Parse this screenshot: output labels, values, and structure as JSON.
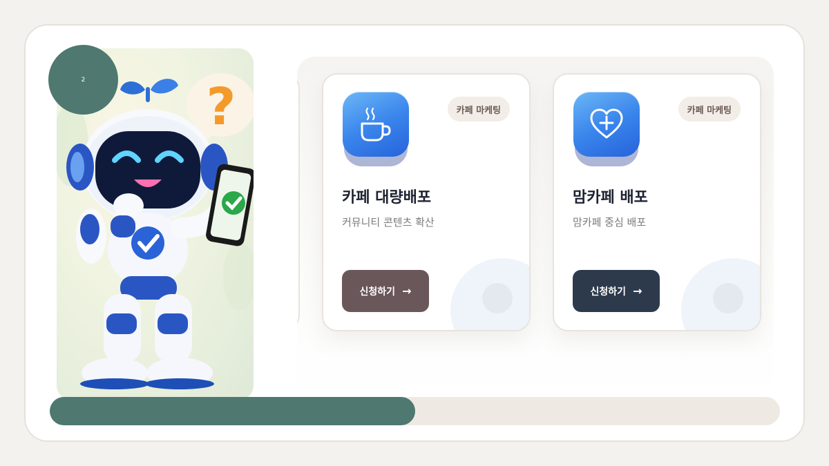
{
  "slide": {
    "number": "2"
  },
  "mascot": {
    "icon": "robot-mascot-illustration"
  },
  "cards": [
    {
      "tag": "카페 마케팅",
      "title": "카페 대량배포",
      "subtitle": "커뮤니티 콘텐츠 확산",
      "button_label": "신청하기",
      "button_arrow": "→",
      "icon": "coffee-cup-icon",
      "button_color": "#6a5759"
    },
    {
      "tag": "카페 마케팅",
      "title": "맘카페 배포",
      "subtitle": "맘카페 중심 배포",
      "button_label": "신청하기",
      "button_arrow": "→",
      "icon": "heart-plus-icon",
      "button_color": "#2d3a4c"
    }
  ],
  "progress": {
    "fraction": 0.5
  },
  "colors": {
    "accent": "#4e7870",
    "icon_blue": "#3a86ec"
  }
}
